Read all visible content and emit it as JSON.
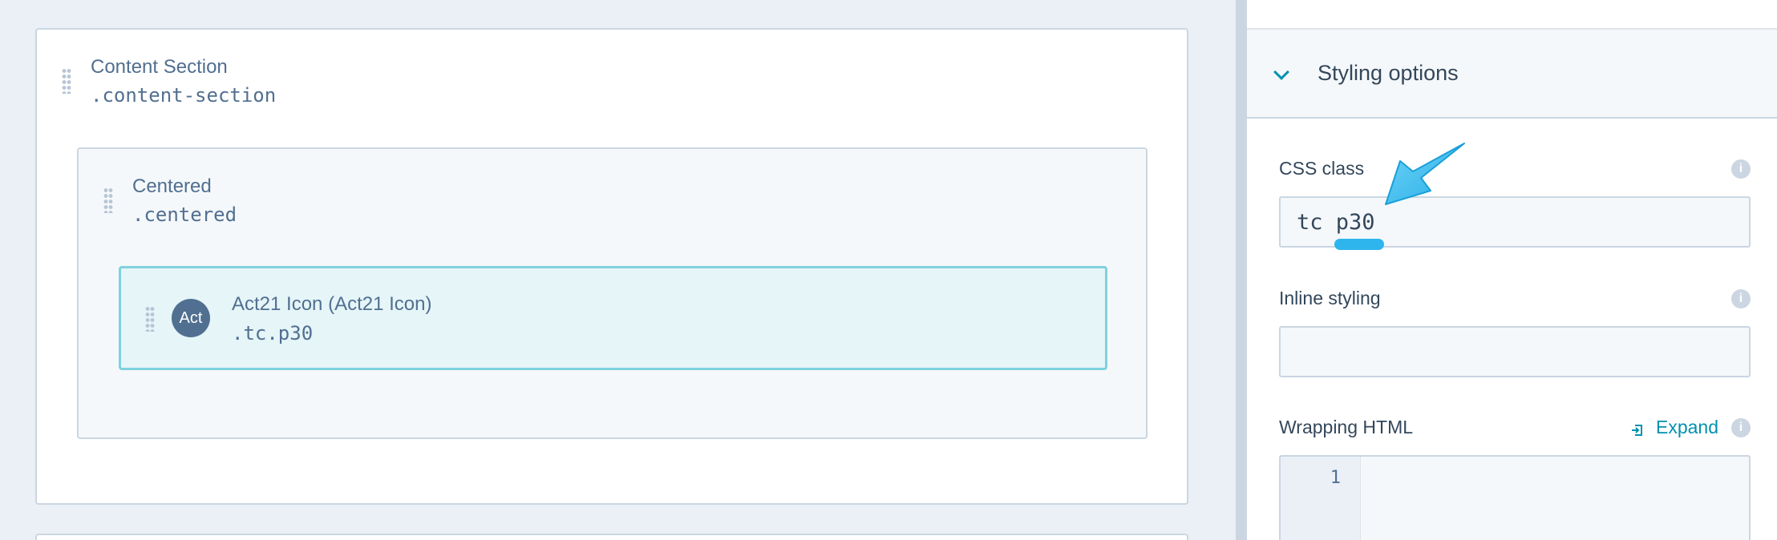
{
  "canvas": {
    "content_section": {
      "title": "Content Section",
      "class_name": ".content-section"
    },
    "centered": {
      "title": "Centered",
      "class_name": ".centered"
    },
    "module": {
      "icon_text": "Act",
      "title": "Act21 Icon (Act21 Icon)",
      "class_name": ".tc.p30"
    }
  },
  "sidebar": {
    "panel_title": "Styling options",
    "css_class": {
      "label": "CSS class",
      "value": "tc p30"
    },
    "inline_styling": {
      "label": "Inline styling",
      "value": ""
    },
    "wrapping_html": {
      "label": "Wrapping HTML",
      "expand_label": "Expand",
      "line_number": "1"
    },
    "info_glyph": "i"
  },
  "colors": {
    "accent": "#0091ae",
    "annotation": "#2fb5ee",
    "text": "#33475b",
    "border": "#cbd6e2"
  }
}
